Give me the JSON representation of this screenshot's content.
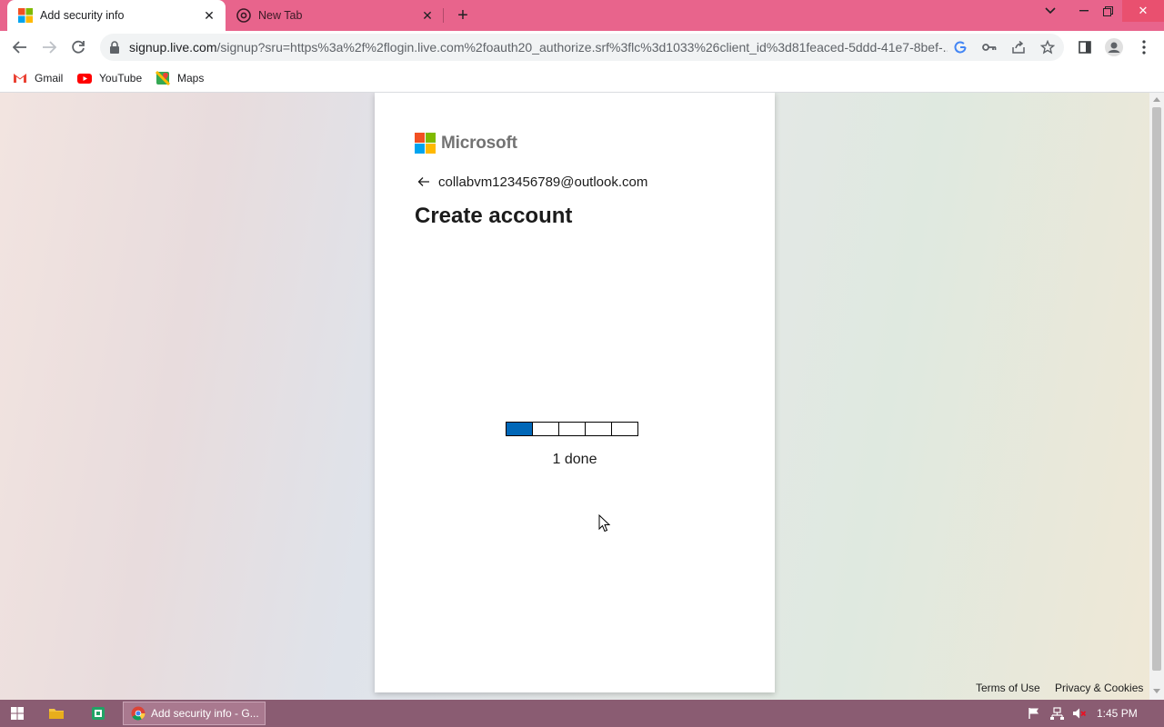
{
  "browser": {
    "tabs": [
      {
        "title": "Add security info",
        "active": true
      },
      {
        "title": "New Tab",
        "active": false
      }
    ],
    "url_host": "signup.live.com",
    "url_rest": "/signup?sru=https%3a%2f%2flogin.live.com%2foauth20_authorize.srf%3flc%3d1033%26client_id%3d81feaced-5ddd-41e7-8bef-...",
    "bookmarks": [
      {
        "label": "Gmail"
      },
      {
        "label": "YouTube"
      },
      {
        "label": "Maps"
      }
    ]
  },
  "page": {
    "brand": "Microsoft",
    "identity": "collabvm123456789@outlook.com",
    "heading": "Create account",
    "progress": {
      "done": 1,
      "total": 5,
      "label": "1 done"
    },
    "footer": {
      "terms": "Terms of Use",
      "privacy": "Privacy & Cookies"
    }
  },
  "taskbar": {
    "chrome_label": "Add security info - G...",
    "clock": "1:45 PM"
  },
  "colors": {
    "tab_strip": "#e8648c",
    "progress_fill": "#0067b8",
    "taskbar": "#8a5c72"
  }
}
